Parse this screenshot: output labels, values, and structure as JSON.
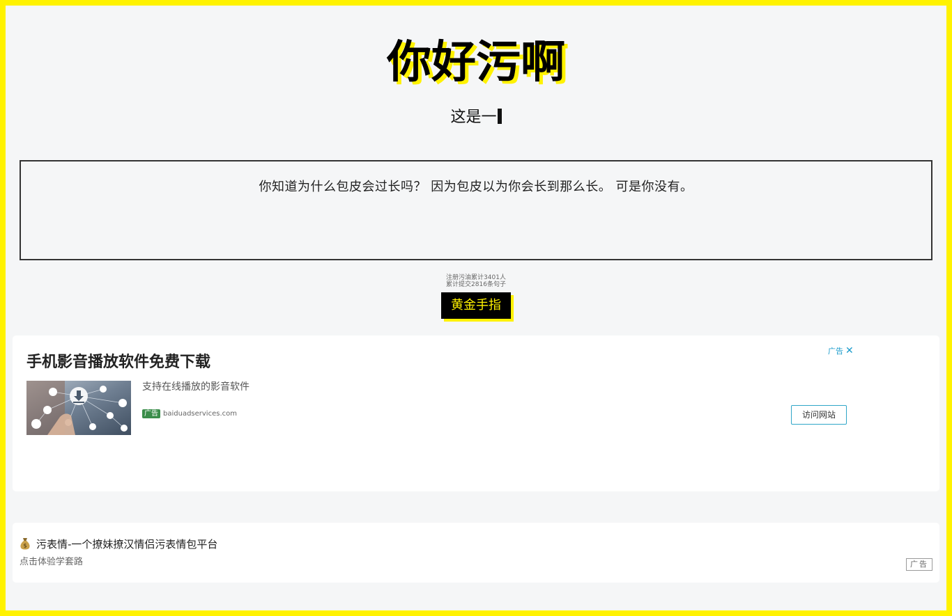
{
  "header": {
    "logo_text": "你好污啊",
    "subtitle": "这是一"
  },
  "sentence": {
    "text": "你知道为什么包皮会过长吗？ 因为包皮以为你会长到那么长。 可是你没有。"
  },
  "stats": {
    "line1": "注册污油累计3401人",
    "line2": "累计提交2816条句子"
  },
  "gold_button": {
    "label": "黄金手指"
  },
  "ad": {
    "title": "手机影音播放软件免费下载",
    "ad_mark_label": "广告",
    "description": "支持在线播放的影音软件",
    "badge": "广告",
    "source": "baiduadservices.com",
    "visit_label": "访问网站"
  },
  "promo": {
    "title": "污表情-一个撩妹撩汉情侣污表情包平台",
    "subtitle": "点击体验学套路",
    "badge": "广告"
  },
  "icons": {
    "moneybag": "moneybag-icon",
    "close": "close-icon"
  },
  "colors": {
    "accent_yellow": "#fff200",
    "ad_blue": "#1a9bcb",
    "badge_green": "#3a8d4a"
  }
}
